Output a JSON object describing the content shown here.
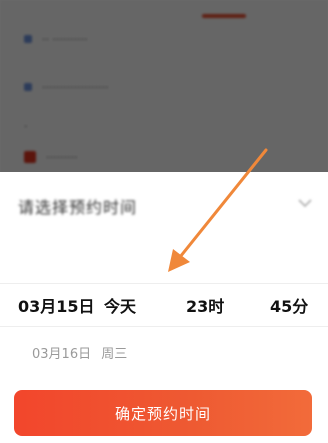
{
  "background": {
    "rows": [
      {
        "text": "·· ··········"
      },
      {
        "text": "···················"
      },
      {
        "text": "·"
      },
      {
        "text": "·········"
      }
    ]
  },
  "sheet": {
    "title": "请选择预约时间",
    "selected": {
      "date": "03月15日",
      "day": "今天",
      "hour": "23时",
      "minute": "45分"
    },
    "next": {
      "date": "03月16日",
      "day": "周三"
    },
    "confirm_label": "确定预约时间"
  },
  "colors": {
    "accent": "#f2462c",
    "arrow": "#f0883a"
  },
  "icons": {
    "close": "close-icon"
  }
}
